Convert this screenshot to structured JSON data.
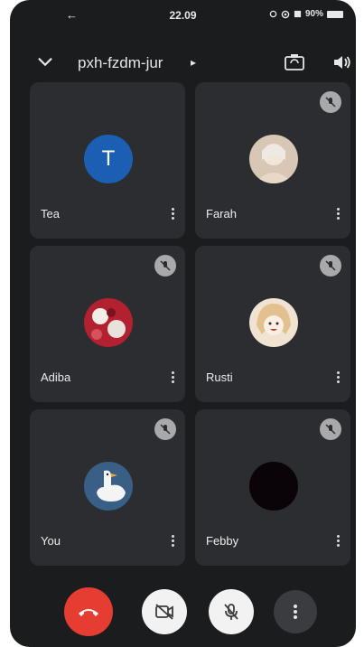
{
  "status_bar": {
    "nav_glyph": "←",
    "time": "22.09",
    "battery_text": "90%"
  },
  "header": {
    "meeting_code": "pxh-fzdm-jur",
    "caret": "▸",
    "icons": [
      "chevron-down-icon",
      "switch-camera-icon",
      "speaker-icon"
    ]
  },
  "participants": [
    {
      "name": "Tea",
      "avatar_letter": "T",
      "avatar_color": "#1a5fb4",
      "muted": false
    },
    {
      "name": "Farah",
      "avatar_color": "#d9c7b6",
      "muted": true
    },
    {
      "name": "Adiba",
      "avatar_color": "#b3202f",
      "muted": true
    },
    {
      "name": "Rusti",
      "avatar_color": "#f0e3d2",
      "muted": true
    },
    {
      "name": "You",
      "avatar_color": "#3a5f86",
      "muted": true
    },
    {
      "name": "Febby",
      "avatar_color": "#0a0307",
      "muted": true
    }
  ],
  "controls": {
    "end_call_color": "#e53d31",
    "icons": [
      "end-call-icon",
      "camera-off-icon",
      "mic-off-icon",
      "more-vert-icon"
    ]
  },
  "colors": {
    "background": "#1b1c1e",
    "tile": "#2b2d30"
  }
}
